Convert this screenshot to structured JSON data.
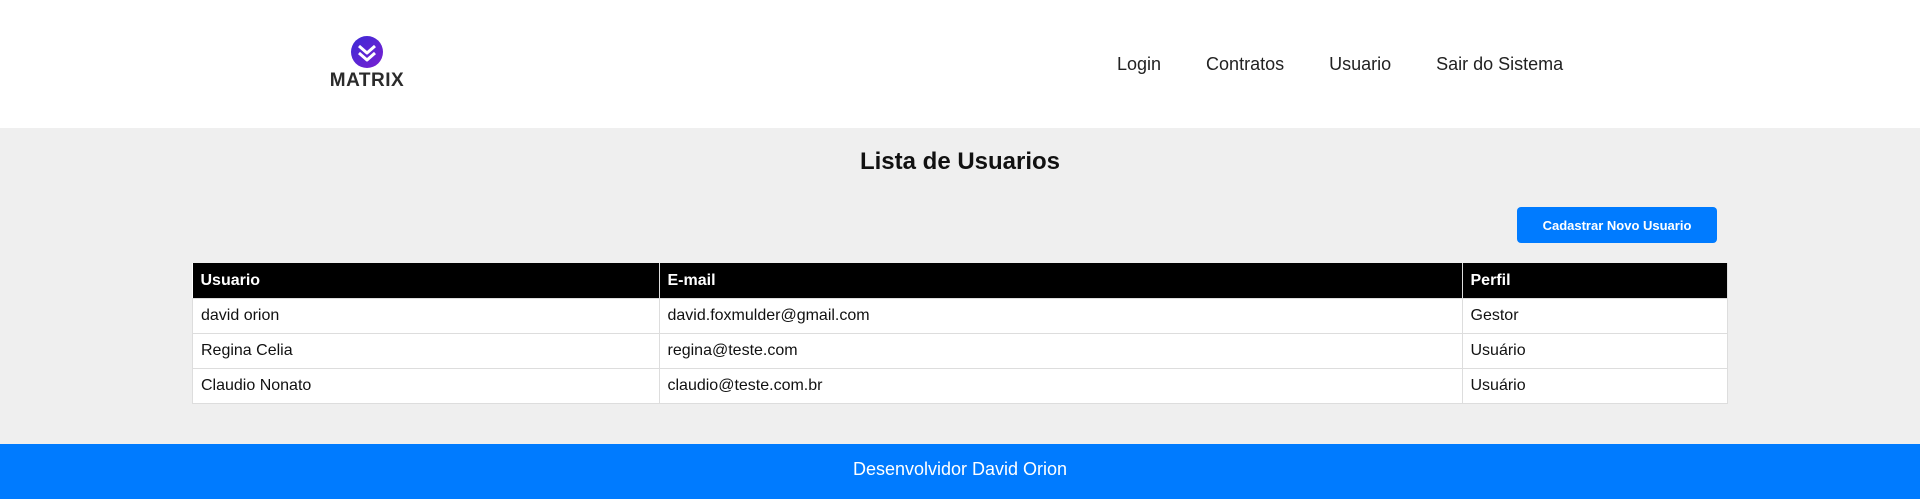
{
  "header": {
    "logo_text": "MATRIX",
    "nav": [
      {
        "label": "Login"
      },
      {
        "label": "Contratos"
      },
      {
        "label": "Usuario"
      },
      {
        "label": "Sair do Sistema"
      }
    ]
  },
  "main": {
    "title": "Lista de Usuarios",
    "new_button_label": "Cadastrar Novo Usuario",
    "table": {
      "columns": [
        "Usuario",
        "E-mail",
        "Perfil"
      ],
      "rows": [
        {
          "usuario": "david orion",
          "email": "david.foxmulder@gmail.com",
          "perfil": "Gestor"
        },
        {
          "usuario": "Regina Celia",
          "email": "regina@teste.com",
          "perfil": "Usuário"
        },
        {
          "usuario": "Claudio Nonato",
          "email": "claudio@teste.com.br",
          "perfil": "Usuário"
        }
      ]
    }
  },
  "footer": {
    "text": "Desenvolvidor David Orion"
  },
  "colors": {
    "accent": "#007bff",
    "table_header_bg": "#000000",
    "logo_gradient_start": "#3b2bd6",
    "logo_gradient_end": "#7a1fd1"
  },
  "icons": {
    "logo": "matrix-chevron-logo-icon"
  }
}
